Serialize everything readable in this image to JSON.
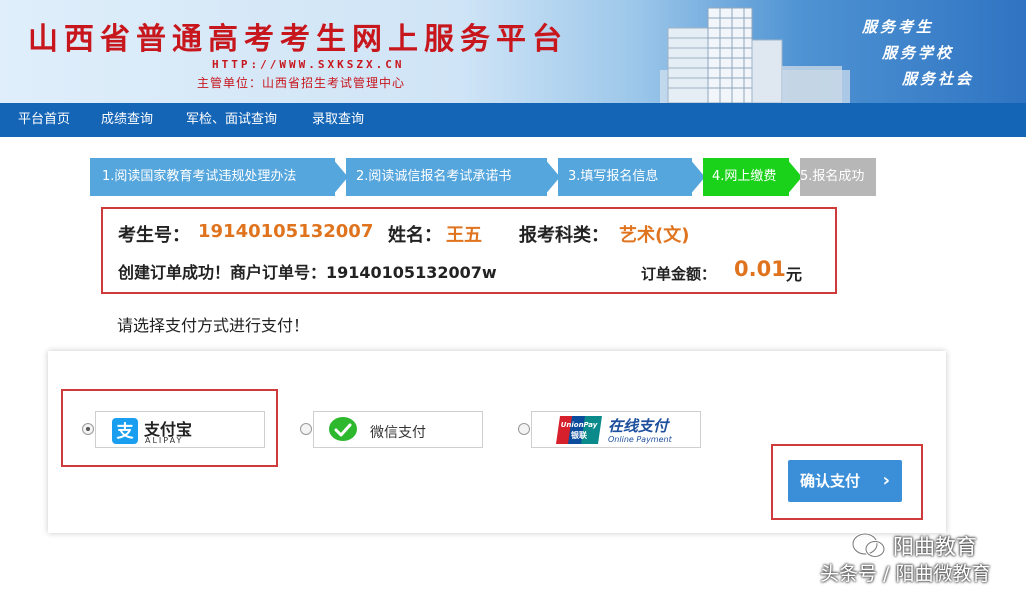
{
  "header": {
    "title": "山西省普通高考考生网上服务平台",
    "url": "HTTP://WWW.SXKSZX.CN",
    "host_org": "主管单位：山西省招生考试管理中心",
    "slogans": [
      "服务考生",
      "服务学校",
      "服务社会"
    ]
  },
  "nav": {
    "items": [
      "平台首页",
      "成绩查询",
      "军检、面试查询",
      "录取查询"
    ]
  },
  "steps": [
    {
      "label": "1.阅读国家教育考试违规处理办法",
      "state": "done"
    },
    {
      "label": "2.阅读诚信报名考试承诺书",
      "state": "done"
    },
    {
      "label": "3.填写报名信息",
      "state": "done"
    },
    {
      "label": "4.网上缴费",
      "state": "current"
    },
    {
      "label": "5.报名成功",
      "state": "pending"
    }
  ],
  "order": {
    "candidate_id_label": "考生号：",
    "candidate_id": "19140105132007",
    "name_label": "姓名：",
    "name": "王五",
    "category_label": "报考科类：",
    "category": "艺术(文)",
    "success_msg": "创建订单成功！商户订单号：19140105132007w",
    "amount_label": "订单金额：",
    "amount": "0.01",
    "unit": "元"
  },
  "pay_prompt": "请选择支付方式进行支付！",
  "payment": {
    "options": [
      {
        "id": "alipay",
        "label": "支付宝",
        "sub": "ALIPAY",
        "selected": true
      },
      {
        "id": "wechat",
        "label": "微信支付",
        "selected": false
      },
      {
        "id": "unionpay",
        "label": "在线支付",
        "sub": "Online Payment",
        "badge_top": "UnionPay",
        "badge_bottom": "银联",
        "selected": false
      }
    ],
    "confirm_label": "确认支付",
    "confirm_chevron": "›"
  },
  "watermark": {
    "line1": "阳曲教育",
    "line2": "头条号 / 阳曲微教育"
  },
  "colors": {
    "brand_red": "#c8161d",
    "nav_blue": "#1565b7",
    "step_blue": "#56a6de",
    "step_green": "#1ad21a",
    "step_gray": "#b7b7b7",
    "highlight_red": "#cf3b3b",
    "value_orange": "#e0731d",
    "button_blue": "#3a8fd8",
    "alipay_blue": "#1a9ff0",
    "wechat_green": "#2eb82e"
  }
}
